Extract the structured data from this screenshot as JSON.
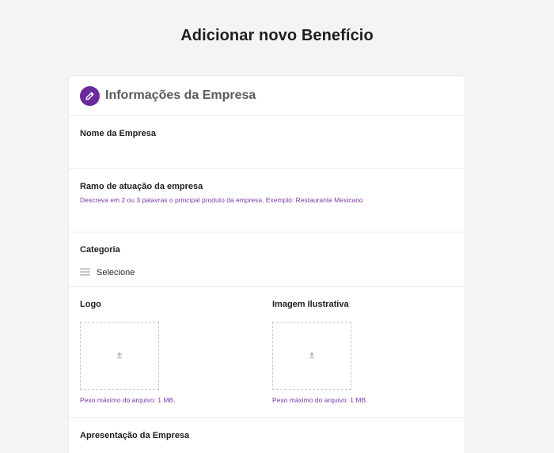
{
  "page": {
    "title": "Adicionar novo Benefício"
  },
  "card": {
    "title": "Informações da Empresa",
    "icon": "pencil-icon",
    "accent": "#6a2a9e"
  },
  "fields": {
    "nome": {
      "label": "Nome da Empresa"
    },
    "ramo": {
      "label": "Ramo de atuação da empresa",
      "hint": "Descreva em 2 ou 3 palavras o principal produto da empresa. Exemplo: Restaurante Mexicano"
    },
    "categoria": {
      "label": "Categoria",
      "value": "Selecione",
      "icon": "menu-lines-icon"
    },
    "logo": {
      "label": "Logo",
      "hint": "Peso máximo do arquivo: 1 MB.",
      "icon": "upload-icon"
    },
    "imagem": {
      "label": "Imagem Ilustrativa",
      "hint": "Peso máximo do arquivo: 1 MB.",
      "icon": "upload-icon"
    },
    "apresentacao": {
      "label": "Apresentação da Empresa"
    }
  }
}
